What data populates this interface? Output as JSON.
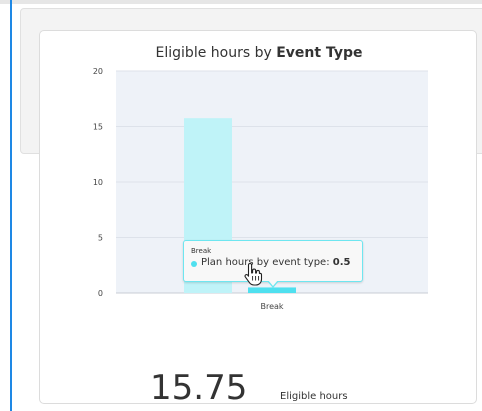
{
  "widget": {
    "title_prefix": "Eligible hours by ",
    "title_bold": "Event Type",
    "summary_value": "15.75",
    "summary_label": "Eligible hours"
  },
  "tooltip": {
    "header": "Break",
    "series_label": "Plan hours by event type:",
    "series_value": "0.5"
  },
  "colors": {
    "plot_bg": "#eef2f8",
    "bar_primary": "#bff3f8",
    "bar_secondary": "#4fe0ef",
    "accent": "#1e88e5"
  },
  "chart_data": {
    "type": "bar",
    "categories": [
      "Break"
    ],
    "series": [
      {
        "name": "",
        "values": [
          15.75
        ]
      },
      {
        "name": "Plan hours by event type",
        "values": [
          0.5
        ]
      }
    ],
    "title": "Eligible hours by Event Type",
    "xlabel": "",
    "ylabel": "",
    "ylim": [
      0,
      20
    ],
    "yticks": [
      "0",
      "5",
      "10",
      "15",
      "20"
    ],
    "grid": true
  }
}
